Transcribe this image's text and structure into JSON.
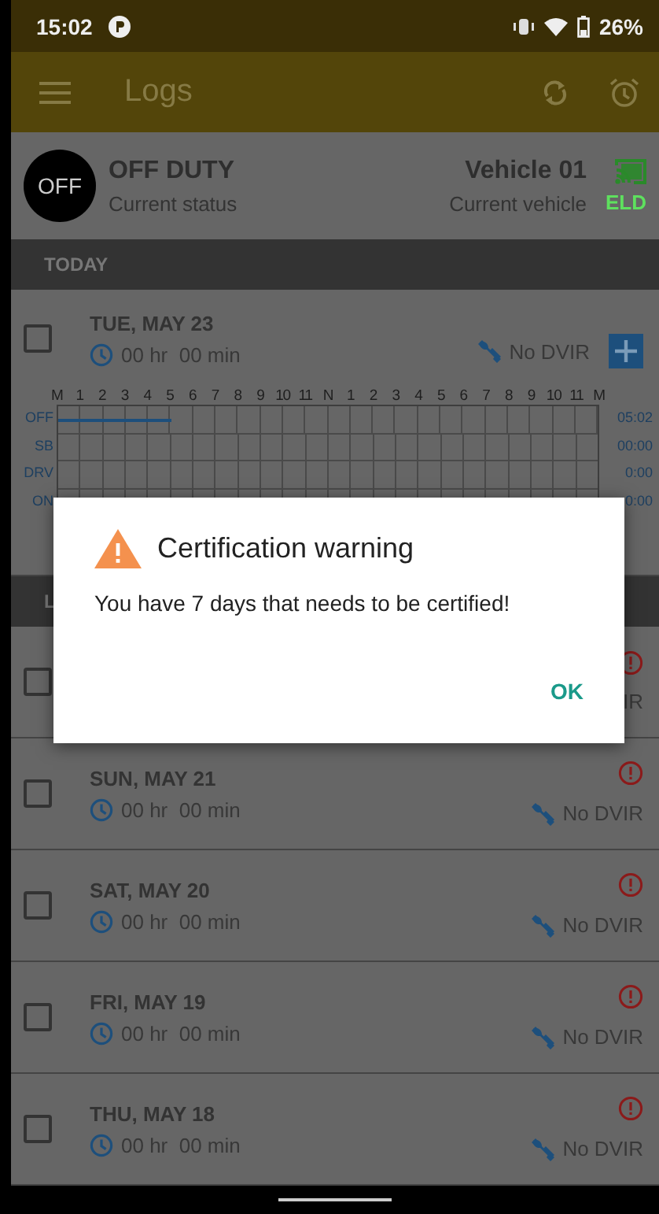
{
  "status_bar": {
    "time": "15:02",
    "battery": "26%"
  },
  "app_bar": {
    "title": "Logs"
  },
  "current": {
    "status_badge": "OFF",
    "status": "OFF DUTY",
    "status_caption": "Current status",
    "vehicle": "Vehicle 01",
    "vehicle_caption": "Current vehicle",
    "eld_label": "ELD"
  },
  "today": {
    "header": "TODAY",
    "log": {
      "date": "TUE, MAY 23",
      "checked": false,
      "warning": false,
      "duration": "00 hr  00 min",
      "dvir": "No DVIR"
    },
    "graph": {
      "hours": [
        "M",
        "1",
        "2",
        "3",
        "4",
        "5",
        "6",
        "7",
        "8",
        "9",
        "10",
        "11",
        "N",
        "1",
        "2",
        "3",
        "4",
        "5",
        "6",
        "7",
        "8",
        "9",
        "10",
        "11",
        "M"
      ],
      "rows": [
        {
          "label": "OFF",
          "level": 0.21,
          "total": "05:02"
        },
        {
          "label": "SB",
          "total": "00:00"
        },
        {
          "label": "DRV",
          "total": "0:00"
        },
        {
          "label": "ON",
          "total": "0:00"
        }
      ]
    }
  },
  "earlier": {
    "header": "L",
    "logs": [
      {
        "checked": false,
        "warning": true,
        "dvir": "IR"
      },
      {
        "date": "SUN, MAY 21",
        "checked": false,
        "warning": true,
        "duration": "00 hr  00 min",
        "dvir": "No DVIR"
      },
      {
        "date": "SAT, MAY 20",
        "checked": false,
        "warning": true,
        "duration": "00 hr  00 min",
        "dvir": "No DVIR"
      },
      {
        "date": "FRI, MAY 19",
        "checked": false,
        "warning": true,
        "duration": "00 hr  00 min",
        "dvir": "No DVIR"
      },
      {
        "date": "THU, MAY 18",
        "checked": false,
        "warning": true,
        "duration": "00 hr  00 min",
        "dvir": "No DVIR"
      }
    ]
  },
  "dialog": {
    "title": "Certification warning",
    "message": "You have 7 days that needs to be certified!",
    "button": "OK"
  }
}
